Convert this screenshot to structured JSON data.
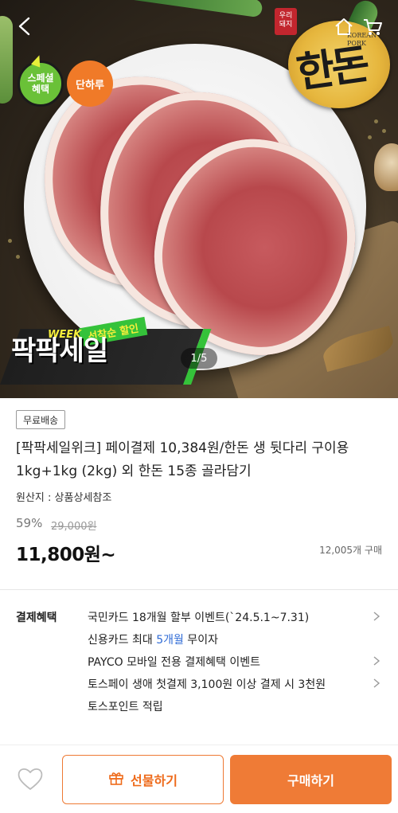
{
  "hero": {
    "pager": "1/5",
    "badges": {
      "special_line1": "스페셜",
      "special_line2": "혜택",
      "day": "단하루"
    },
    "brand": {
      "seal_line1": "우리",
      "seal_line2": "돼지",
      "logo_text": "한돈",
      "logo_en_line1": "KOREAN",
      "logo_en_line2": "PORK"
    },
    "week_banner": {
      "ribbon": "선착순 할인",
      "week": "WEEK",
      "title": "팍팍세일"
    }
  },
  "product": {
    "shipping_badge": "무료배송",
    "title": "[팍팍세일위크] 페이결제 10,384원/한돈 생 뒷다리 구이용 1kg+1kg (2kg) 외 한돈 15종 골라담기",
    "origin": "원산지 : 상품상세참조",
    "discount_rate": "59%",
    "original_price": "29,000원",
    "price": "11,800원~",
    "sold_count": "12,005개 구매"
  },
  "benefits": {
    "label": "결제혜택",
    "items": [
      {
        "text": "국민카드 18개월 할부 이벤트(`24.5.1~7.31)",
        "has_chevron": true
      },
      {
        "text_before": "신용카드 최대 ",
        "highlight": "5개월",
        "text_after": " 무이자",
        "has_chevron": false
      },
      {
        "text": "PAYCO 모바일 전용 결제혜택 이벤트",
        "has_chevron": true
      },
      {
        "text": "토스페이 생애 첫결제 3,100원 이상 결제 시 3천원",
        "has_chevron": true
      },
      {
        "text": "토스포인트 적립",
        "has_chevron": false
      }
    ]
  },
  "bottom_bar": {
    "gift_label": "선물하기",
    "buy_label": "구매하기"
  },
  "colors": {
    "accent": "#ef7b36",
    "highlight_blue": "#2f6bd6",
    "green_badge": "#6ac138",
    "orange_badge": "#f07a28"
  },
  "icons": [
    "back-arrow-icon",
    "home-icon",
    "cart-icon",
    "heart-icon",
    "gift-icon",
    "chevron-right-icon"
  ]
}
